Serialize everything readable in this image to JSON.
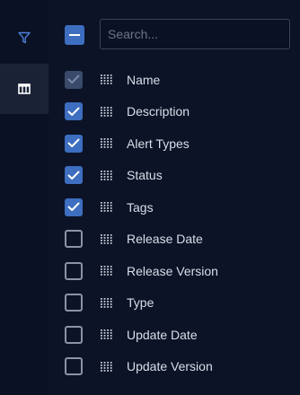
{
  "rail": {
    "filter_icon": "filter-icon",
    "columns_icon": "columns-icon"
  },
  "search": {
    "placeholder": "Search...",
    "value": ""
  },
  "columns": [
    {
      "label": "Name",
      "checked": true,
      "disabled": true
    },
    {
      "label": "Description",
      "checked": true,
      "disabled": false
    },
    {
      "label": "Alert Types",
      "checked": true,
      "disabled": false
    },
    {
      "label": "Status",
      "checked": true,
      "disabled": false
    },
    {
      "label": "Tags",
      "checked": true,
      "disabled": false
    },
    {
      "label": "Release Date",
      "checked": false,
      "disabled": false
    },
    {
      "label": "Release Version",
      "checked": false,
      "disabled": false
    },
    {
      "label": "Type",
      "checked": false,
      "disabled": false
    },
    {
      "label": "Update Date",
      "checked": false,
      "disabled": false
    },
    {
      "label": "Update Version",
      "checked": false,
      "disabled": false
    }
  ],
  "colors": {
    "accent": "#3d6ec0",
    "background": "#0a1124",
    "rail_active": "#1a2236",
    "text": "#d9deea"
  }
}
